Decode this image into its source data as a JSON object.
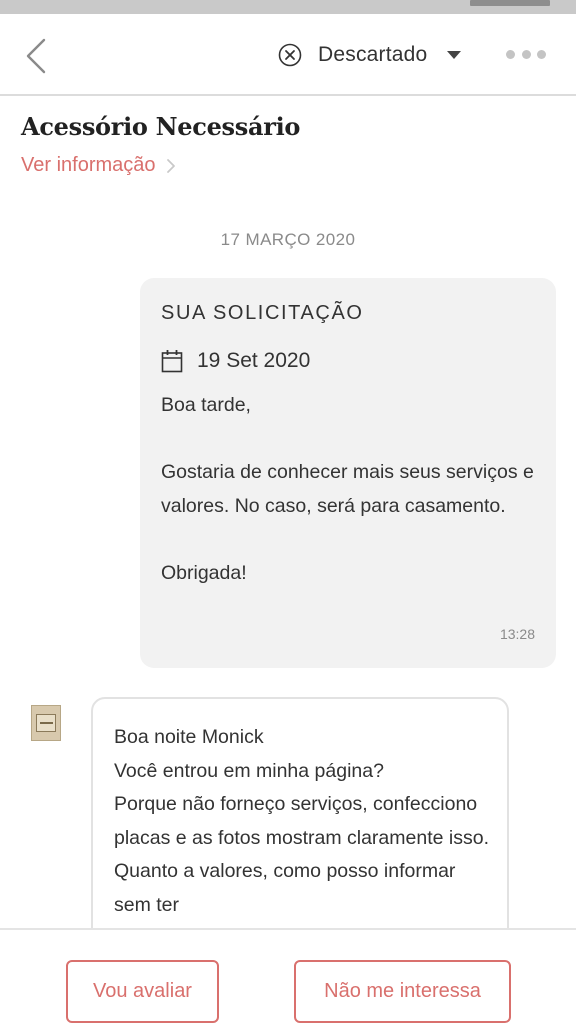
{
  "header": {
    "status_label": "Descartado",
    "icons": {
      "back": "chevron-left-icon",
      "status": "close-circle-icon",
      "dropdown": "caret-down-icon",
      "more": "more-dots-icon"
    }
  },
  "vendor": {
    "name": "Acessório Necessário",
    "info_link": "Ver informação"
  },
  "conversation": {
    "date_separator": "17 MARÇO 2020",
    "request": {
      "heading": "SUA SOLICITAÇÃO",
      "event_date": "19 Set 2020",
      "message": "Boa tarde,\n\nGostaria de conhecer mais seus serviços e valores. No caso, será para casamento.\n\nObrigada!",
      "time": "13:28"
    },
    "reply": {
      "message": "Boa noite Monick\nVocê entrou em minha página?\nPorque não forneço serviços, confecciono placas e as fotos mostram claramente isso. Quanto a valores, como posso informar sem ter"
    }
  },
  "actions": {
    "evaluate_label": "Vou avaliar",
    "decline_label": "Não me interessa"
  },
  "colors": {
    "accent": "#d9706d",
    "bubble_bg": "#f2f2f2",
    "text": "#333333",
    "muted": "#8a8a8a"
  }
}
